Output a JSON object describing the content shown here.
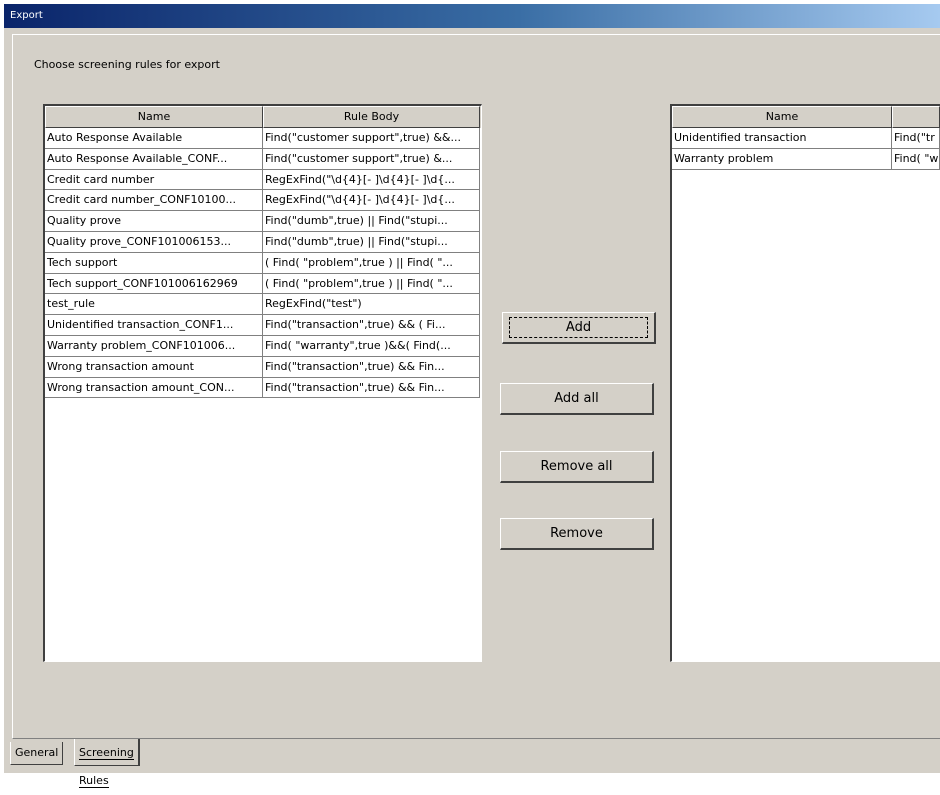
{
  "window": {
    "title": "Export"
  },
  "instruction": "Choose screening rules for export",
  "available": {
    "columns": [
      "Name",
      "Rule Body"
    ],
    "rows": [
      [
        "Auto Response Available",
        "Find(\"customer support\",true) &&..."
      ],
      [
        "Auto Response Available_CONF...",
        "Find(\"customer support\",true) &..."
      ],
      [
        "Credit card number",
        "RegExFind(\"\\d{4}[- ]\\d{4}[- ]\\d{..."
      ],
      [
        "Credit card number_CONF10100...",
        "RegExFind(\"\\d{4}[- ]\\d{4}[- ]\\d{..."
      ],
      [
        "Quality prove",
        "Find(\"dumb\",true) || Find(\"stupi..."
      ],
      [
        "Quality prove_CONF101006153...",
        "Find(\"dumb\",true) || Find(\"stupi..."
      ],
      [
        "Tech support",
        "( Find( \"problem\",true ) || Find( \"..."
      ],
      [
        "Tech support_CONF101006162969",
        "( Find( \"problem\",true ) || Find( \"..."
      ],
      [
        "test_rule",
        "RegExFind(\"test\")"
      ],
      [
        "Unidentified transaction_CONF1...",
        "Find(\"transaction\",true) && ( Fi..."
      ],
      [
        "Warranty problem_CONF101006...",
        "Find( \"warranty\",true )&&( Find(..."
      ],
      [
        "Wrong transaction amount",
        "Find(\"transaction\",true) && Fin..."
      ],
      [
        "Wrong transaction amount_CON...",
        "Find(\"transaction\",true) && Fin..."
      ]
    ]
  },
  "selected": {
    "columns": [
      "Name",
      ""
    ],
    "rows": [
      [
        "Unidentified transaction",
        "Find(\"tr"
      ],
      [
        "Warranty problem",
        "Find( \"w"
      ]
    ]
  },
  "buttons": {
    "add": "Add",
    "add_all": "Add all",
    "remove_all": "Remove all",
    "remove": "Remove"
  },
  "tabs": [
    "General",
    "Screening Rules"
  ]
}
